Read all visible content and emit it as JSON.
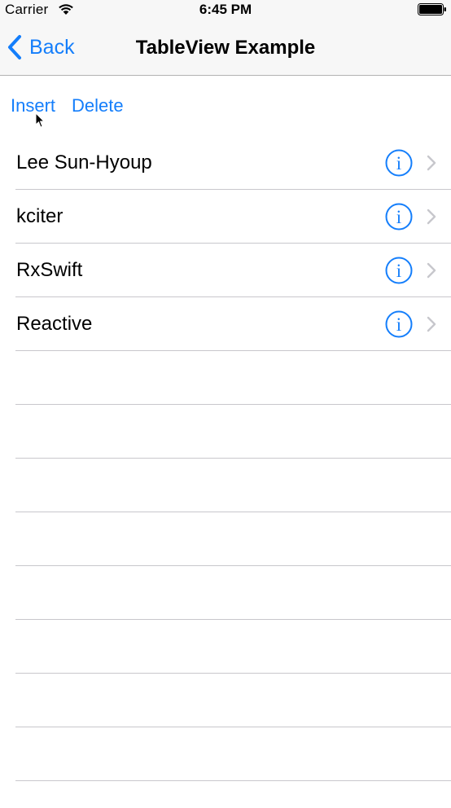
{
  "status_bar": {
    "carrier": "Carrier",
    "time": "6:45 PM",
    "wifi_icon": "wifi-icon",
    "battery_icon": "battery-icon"
  },
  "nav_bar": {
    "back_label": "Back",
    "back_icon": "chevron-left-icon",
    "title": "TableView Example"
  },
  "actions": {
    "insert_label": "Insert",
    "delete_label": "Delete"
  },
  "table": {
    "rows": [
      {
        "label": "Lee Sun-Hyoup",
        "accessory": "info-icon"
      },
      {
        "label": "kciter",
        "accessory": "info-icon"
      },
      {
        "label": "RxSwift",
        "accessory": "info-icon"
      },
      {
        "label": "Reactive",
        "accessory": "info-icon"
      }
    ],
    "empty_rows": 8
  },
  "colors": {
    "tint": "#147efb",
    "separator": "#c8c7cc",
    "bar_background": "#f7f7f7"
  }
}
